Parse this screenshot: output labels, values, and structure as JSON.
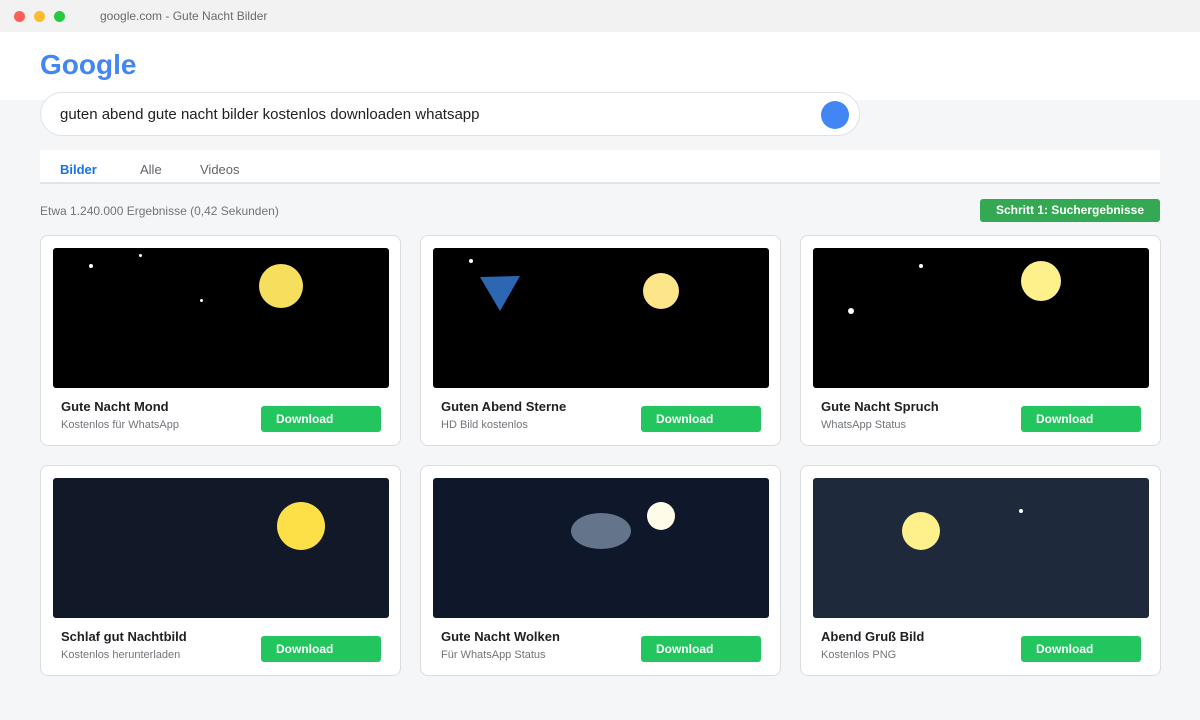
{
  "window": {
    "title": "google.com - Gute Nacht Bilder"
  },
  "logo": "Google",
  "search": {
    "query": "guten abend gute nacht bilder kostenlos downloaden whatsapp"
  },
  "tabs": [
    {
      "label": "Bilder",
      "active": true
    },
    {
      "label": "Alle",
      "active": false
    },
    {
      "label": "Videos",
      "active": false
    }
  ],
  "results": {
    "stats": "Etwa 1.240.000 Ergebnisse (0,42 Sekunden)"
  },
  "step_badge": "Schritt 1: Suchergebnisse",
  "colors": {
    "accent": "#4285f4",
    "download": "#22c55e",
    "badge": "#34a853",
    "tab_active": "#1a73e8"
  },
  "cards": [
    {
      "title": "Gute Nacht Mond",
      "subtitle": "Kostenlos für WhatsApp",
      "download_label": "Download",
      "background": "#000000"
    },
    {
      "title": "Guten Abend Sterne",
      "subtitle": "HD Bild kostenlos",
      "download_label": "Download",
      "background": "#000000"
    },
    {
      "title": "Gute Nacht Spruch",
      "subtitle": "WhatsApp Status",
      "download_label": "Download",
      "background": "#000000"
    },
    {
      "title": "Schlaf gut Nachtbild",
      "subtitle": "Kostenlos herunterladen",
      "download_label": "Download",
      "background": "#111827"
    },
    {
      "title": "Gute Nacht Wolken",
      "subtitle": "Für WhatsApp Status",
      "download_label": "Download",
      "background": "#0f172a"
    },
    {
      "title": "Abend Gruß Bild",
      "subtitle": "Kostenlos PNG",
      "download_label": "Download",
      "background": "#1e293b"
    }
  ]
}
